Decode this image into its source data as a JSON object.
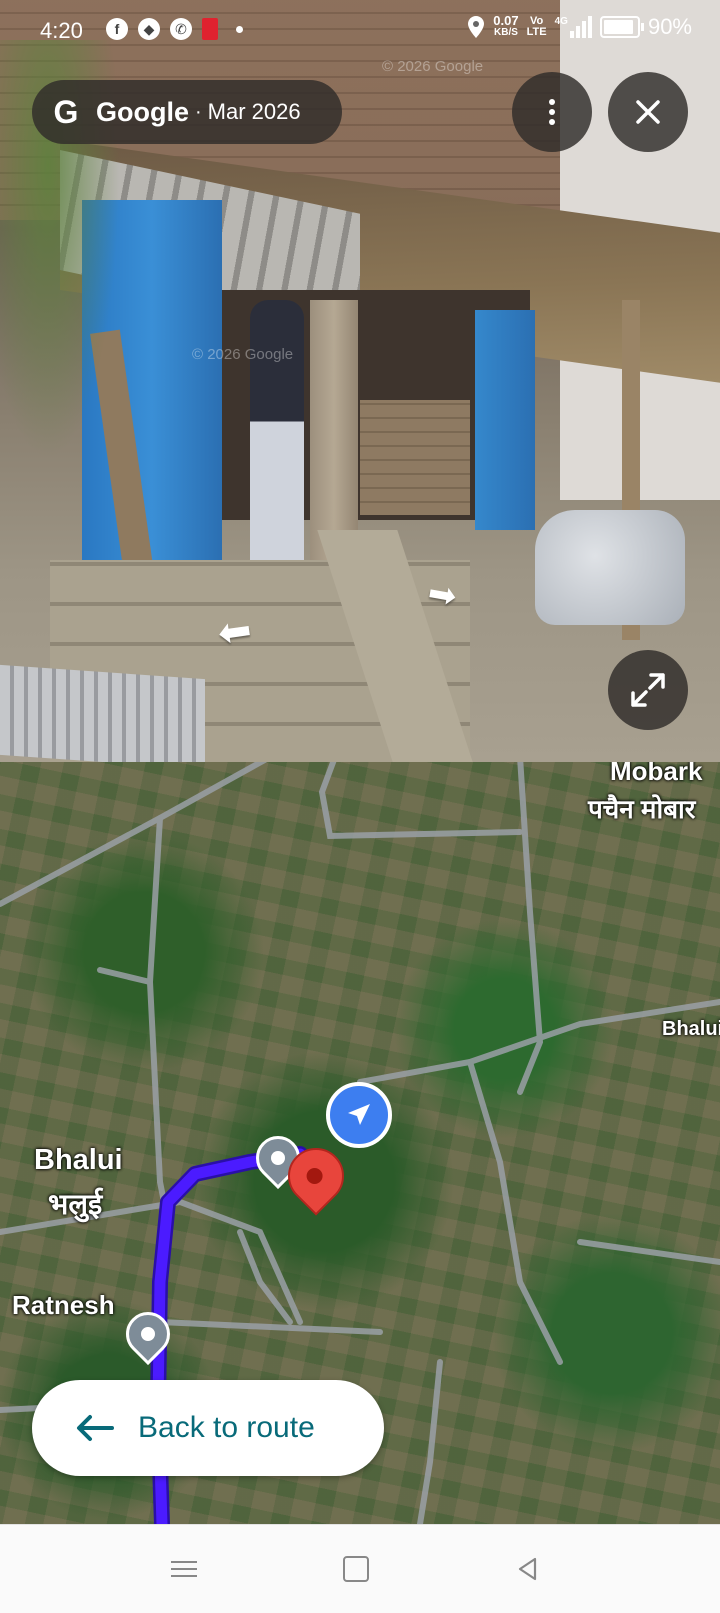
{
  "status_bar": {
    "time": "4:20",
    "data_speed": "0.07",
    "data_speed_unit": "KB/S",
    "volte": "Vo LTE",
    "network": "4G",
    "battery_percent": "90%",
    "battery_level": 0.9,
    "notification_icons": [
      "facebook-icon",
      "messenger-icon",
      "whatsapp-icon",
      "app-notification-icon"
    ]
  },
  "street_view": {
    "provider": "Google",
    "logo_letter": "G",
    "separator": "·",
    "date": "Mar 2026",
    "watermark": "© 2026 Google",
    "more_icon": "more-vertical-icon",
    "close_icon": "close-icon",
    "expand_icon": "expand-icon"
  },
  "map": {
    "labels": {
      "place_top_right_en": "Mobark",
      "place_top_right_hi": "पचैन मोबार",
      "road_label": "Bhalui",
      "village_en": "Bhalui",
      "village_hi": "भलुई",
      "poi_name": "Ratnesh"
    },
    "route_color": "#3d12e6",
    "pin_color": "#e8453c",
    "navigation_button_color": "#3d7ef0"
  },
  "back_to_route": {
    "label": "Back to route",
    "icon": "arrow-left-icon",
    "color": "#086a79"
  },
  "nav_bar": {
    "buttons": [
      "menu-icon",
      "home-icon",
      "back-icon"
    ]
  }
}
